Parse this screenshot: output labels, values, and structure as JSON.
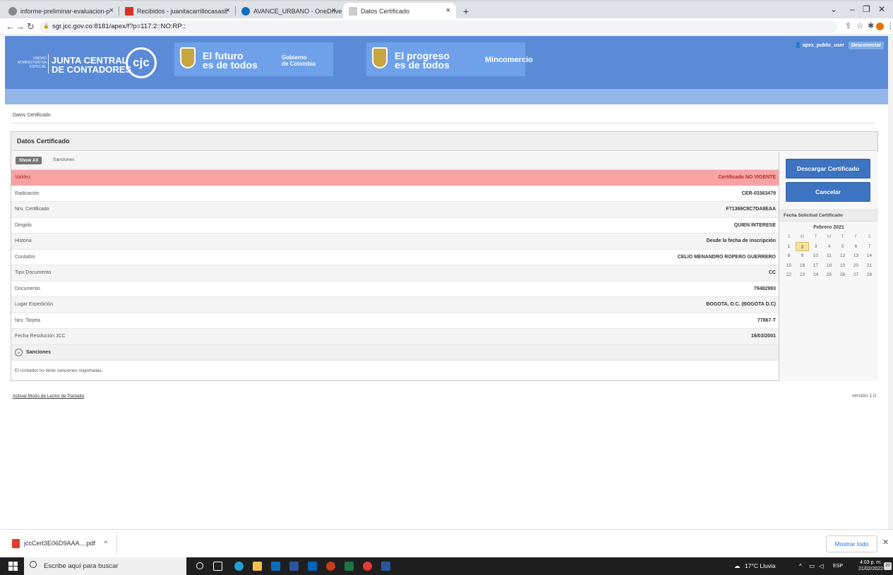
{
  "browser": {
    "tabs": [
      {
        "label": "informe-preliminar-evaluacion-p",
        "icon": "chrome-icon",
        "active": false
      },
      {
        "label": "Recibidos - juanitacarrillocasasb",
        "icon": "gmail-icon",
        "active": false
      },
      {
        "label": "AVANCE_URBANO - OneDrive",
        "icon": "onedrive-icon",
        "active": false
      },
      {
        "label": "Datos Certificado",
        "icon": "page-icon",
        "active": true
      }
    ],
    "new_tab": "+",
    "url": "sgr.jcc.gov.co:8181/apex/f?p=117:2::NO:RP::"
  },
  "header": {
    "org_small": "UNIDAD ADMINISTRATIVA ESPECIAL",
    "org_line1": "JUNTA CENTRAL",
    "org_line2": "DE CONTADORES",
    "org_mark": "cjc",
    "slogan1_line1": "El futuro",
    "slogan1_line2": "es de todos",
    "brand1_line1": "Gobierno",
    "brand1_line2": "de Colombia",
    "slogan2_line1": "El progreso",
    "slogan2_line2": "es de todos",
    "brand2": "Mincomercio",
    "user": "apex_public_user",
    "logout": "Desconectar"
  },
  "breadcrumb": "Datos Certificado",
  "panel": {
    "title": "Datos Certificado",
    "show_all": "Show All",
    "tab_sanciones": "Sanciones",
    "rows": [
      {
        "label": "Validez",
        "value": "Certificado NO VIGENTE"
      },
      {
        "label": "Radicación",
        "value": "CER-03363479"
      },
      {
        "label": "Nro. Certificado",
        "value": "F71369C8C7DA8EAA"
      },
      {
        "label": "Dirigido",
        "value": "QUIEN INTERESE"
      },
      {
        "label": "Historia",
        "value": "Desde la fecha de inscripción"
      },
      {
        "label": "Contador",
        "value": "CELIO MENANDRO ROPERO GUERRERO"
      },
      {
        "label": "Tipo Documento",
        "value": "CC"
      },
      {
        "label": "Documento",
        "value": "79482993"
      },
      {
        "label": "Lugar Expedición",
        "value": "BOGOTA, D.C. (BOGOTA D.C)"
      },
      {
        "label": "Nro. Tarjeta",
        "value": "77867-T"
      },
      {
        "label": "Fecha Resolución JCC",
        "value": "16/03/2001"
      }
    ],
    "sanciones_header": "Sanciones",
    "sanciones_msg": "El contador no tiene sanciones registradas."
  },
  "side": {
    "download_btn": "Descargar Certificado",
    "cancel_btn": "Cancelar",
    "cal_title": "Fecha Solicitud Certificado",
    "cal_month": "Febrero 2021",
    "cal_dow": [
      "S",
      "M",
      "T",
      "W",
      "T",
      "F",
      "S"
    ],
    "cal_days": [
      "1",
      "2",
      "3",
      "4",
      "5",
      "6",
      "7",
      "8",
      "9",
      "10",
      "11",
      "12",
      "13",
      "14",
      "15",
      "16",
      "17",
      "18",
      "19",
      "20",
      "21",
      "22",
      "23",
      "24",
      "25",
      "26",
      "27",
      "28"
    ],
    "cal_selected": "2"
  },
  "footer": {
    "reader_link": "Activar Modo de Lector de Pantalla",
    "version": "versión 1.0"
  },
  "downloads": {
    "file": "jccCert3E06D9AAA....pdf",
    "show_all": "Mostrar todo"
  },
  "taskbar": {
    "search_placeholder": "Escribe aquí para buscar",
    "weather": "17°C Lluvia",
    "lang": "ESP",
    "time": "4:03 p. m.",
    "date": "21/02/2022",
    "notif_count": "20"
  },
  "colors": {
    "header_blue": "#5b8bd6",
    "warn_row": "#f7a3a3",
    "button_blue": "#3d73c0"
  }
}
